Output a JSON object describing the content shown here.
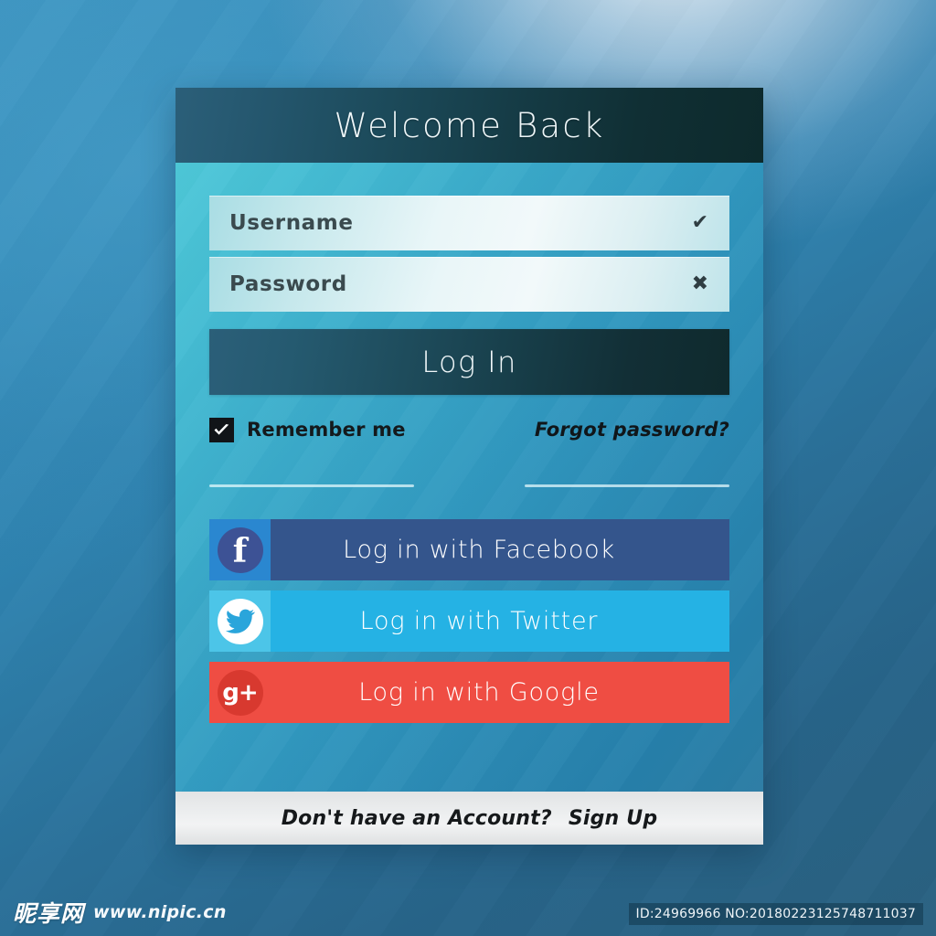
{
  "background": {
    "top_left": "#3690c0",
    "glow": "#e8eef5",
    "bottom_left": "#2b6789",
    "bottom_right": "#2a6180"
  },
  "card": {
    "header": {
      "title": "Welcome Back",
      "bg_left": "#2b5f79",
      "bg_right": "#0d2a2c"
    },
    "body": {
      "bg_top_left": "#4ec8d8",
      "bg_bottom_right": "#2680ab"
    },
    "fields": [
      {
        "name": "username",
        "placeholder": "Username",
        "value": "Username",
        "status_icon": "check-icon",
        "status_glyph": "✔"
      },
      {
        "name": "password",
        "placeholder": "Password",
        "value": "Password",
        "status_icon": "cross-icon",
        "status_glyph": "✖"
      }
    ],
    "login_button": {
      "label": "Log In",
      "bg_left": "#2b5f79",
      "bg_right": "#0f2a2d"
    },
    "remember": {
      "label": "Remember me",
      "checked": true,
      "checkbox_color": "#111418"
    },
    "forgot": {
      "label": "Forgot password?"
    },
    "divider": {
      "color": "#e9fbfd",
      "segments": 2
    },
    "social_buttons": [
      {
        "id": "facebook",
        "label": "Log in with Facebook",
        "icon": "facebook-icon",
        "glyph": "f",
        "bar_color": "#34558c",
        "badge_color": "#2a87d0",
        "circle_color": "#3d5295"
      },
      {
        "id": "twitter",
        "label": "Log in with Twitter",
        "icon": "twitter-icon",
        "glyph": "bird",
        "bar_color": "#25b2e4",
        "badge_color": "#4cc5e8",
        "circle_color": "#ffffff"
      },
      {
        "id": "google",
        "label": "Log in with Google",
        "icon": "google-plus-icon",
        "glyph": "g+",
        "bar_color": "#ef4d43",
        "badge_color": "#ef4d43",
        "circle_color": "#d8392f"
      }
    ],
    "footer": {
      "prompt": "Don't have an Account?",
      "signup_label": "Sign Up"
    }
  },
  "watermark": {
    "logo_cn": "昵享网",
    "url": "www.nipic.cn",
    "id_text": "ID:24969966 NO:20180223125748711037"
  }
}
